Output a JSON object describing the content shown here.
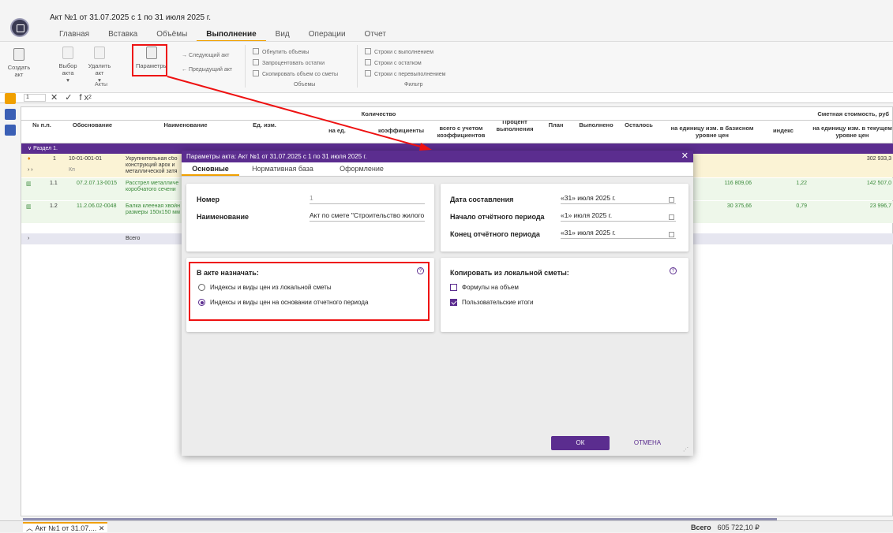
{
  "document_title": "Акт №1 от 31.07.2025 с 1 по 31 июля 2025 г.",
  "menu": [
    "Главная",
    "Вставка",
    "Объёмы",
    "Выполнение",
    "Вид",
    "Операции",
    "Отчет"
  ],
  "ribbon": {
    "create_act": "Создать акт",
    "select_act": "Выбор акта",
    "delete_act": "Удалить акт",
    "params": "Параметры",
    "next_act": "Следующий акт",
    "prev_act": "Предыдущий акт",
    "group_acts": "Акты",
    "zero_volumes": "Обнулить объемы",
    "fill_remain": "Запроцентовать остатки",
    "copy_volume": "Скопировать объем со сметы",
    "group_volumes": "Объемы",
    "rows_done": "Строки с выполнением",
    "rows_remain": "Строки с остатком",
    "rows_over": "Строки с перевыполнением",
    "group_filter": "Фильтр"
  },
  "formula_bar": {
    "cell": "1",
    "value": "2",
    "icons": "✕ ✓ fx"
  },
  "grid": {
    "headers": {
      "num": "№ п.п.",
      "basis": "Обоснование",
      "name": "Наименование",
      "unit": "Ед. изм.",
      "qty": "Количество",
      "per_unit": "на ед.",
      "coef": "коэффициенты",
      "with_coef": "всего с учетом коэффициентов",
      "percent": "Процент выполнения",
      "plan": "План",
      "done": "Выполнено",
      "remain": "Осталось",
      "cost": "Сметная стоимость, руб",
      "base_price": "на единицу изм. в базисном уровне цен",
      "index": "индекс",
      "cur_price": "на единицу изм. в текущем уровне цен"
    },
    "section": "Раздел 1.",
    "rows": [
      {
        "num": "1",
        "basis": "10-01-001-01",
        "basis2": "Кп",
        "name": "Укрупнительная сбо конструкций арок и металлической затя",
        "base": "",
        "index": "",
        "cur": "302 933,3"
      },
      {
        "num": "1.1",
        "basis": "07.2.07.13-0015",
        "basis2": "",
        "name": "Расстрел металличе коробчатого сечени",
        "base": "116 809,06",
        "index": "1,22",
        "cur": "142 507,0"
      },
      {
        "num": "1.2",
        "basis": "11.2.06.02-0048",
        "basis2": "",
        "name": "Балка клееная хвойн размеры 150x150 мм",
        "base": "30 375,66",
        "index": "0,79",
        "cur": "23 996,7"
      }
    ],
    "total_row": "Всего"
  },
  "bottom": {
    "tab": "Акт №1 от 31.07....",
    "total_label": "Всего",
    "total_value": "605 722,10 ₽"
  },
  "dialog": {
    "title": "Параметры акта: Акт №1 от 31.07.2025 с 1 по 31 июля 2025 г.",
    "tabs": [
      "Основные",
      "Нормативная база",
      "Оформление"
    ],
    "number_label": "Номер",
    "number_value": "1",
    "name_label": "Наименование",
    "name_value": "Акт по смете \"Строительство жилого",
    "date_label": "Дата составления",
    "date_value": "«31» июля 2025 г.",
    "start_label": "Начало отчётного периода",
    "start_value": "«1» июля 2025 г.",
    "end_label": "Конец отчётного периода",
    "end_value": "«31» июля 2025 г.",
    "assign_title": "В акте назначать:",
    "assign_opt1": "Индексы и виды цен из локальной сметы",
    "assign_opt2": "Индексы и виды цен на основании отчетного периода",
    "copy_title": "Копировать из локальной сметы:",
    "copy_opt1": "Формулы на объем",
    "copy_opt2": "Пользовательские итоги",
    "ok": "ОК",
    "cancel": "ОТМЕНА"
  }
}
